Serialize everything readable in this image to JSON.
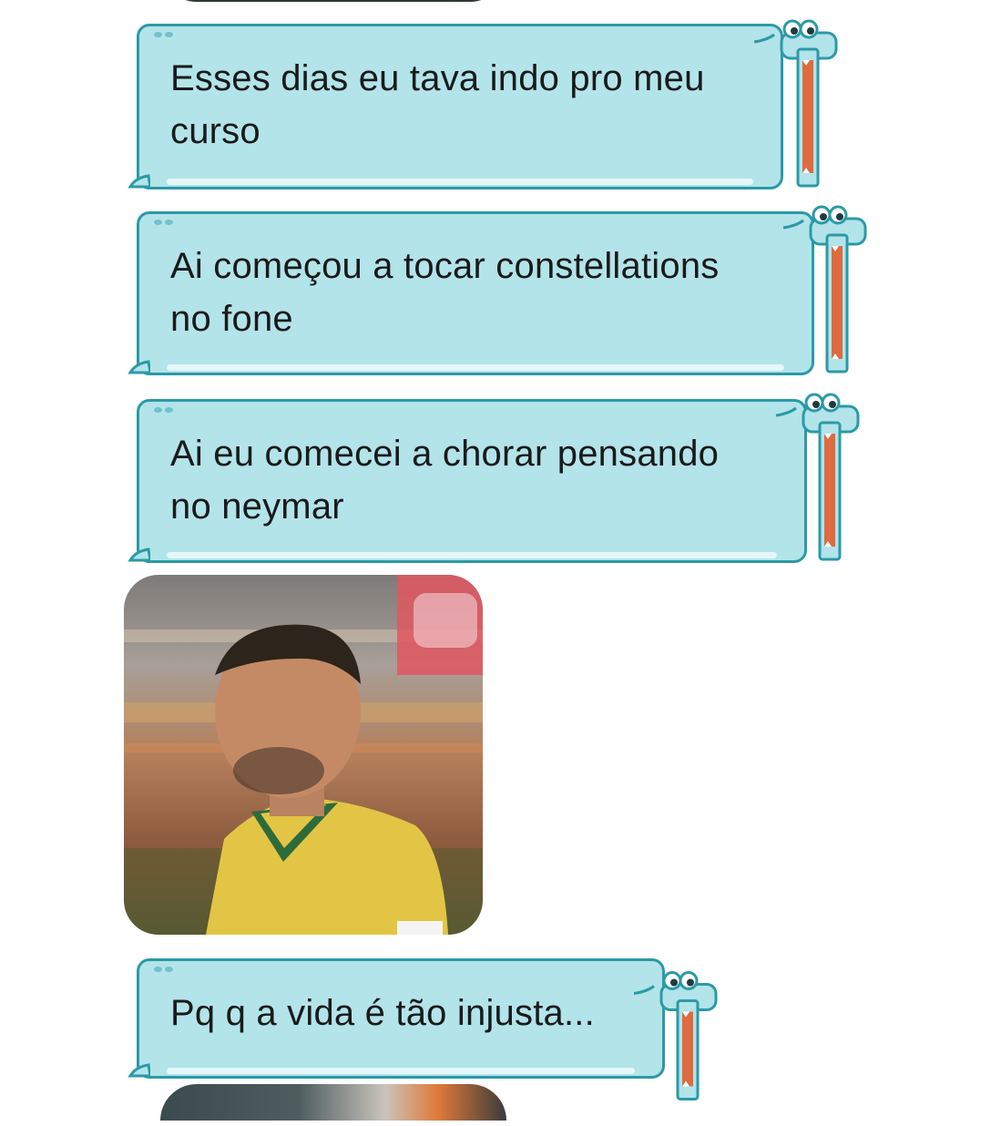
{
  "messages": [
    {
      "type": "text",
      "text": "Esses dias eu tava indo pro meu curso",
      "line1": "Esses dias eu tava indo pro meu",
      "line2": "curso"
    },
    {
      "type": "text",
      "text": "Ai começou a tocar constellations no fone",
      "line1": "Ai começou a tocar constellations",
      "line2": "no fone"
    },
    {
      "type": "text",
      "text": "Ai eu comecei a chorar pensando no neymar",
      "line1": "Ai eu comecei a chorar pensando",
      "line2": "no neymar"
    },
    {
      "type": "image",
      "icon": "crying-player-photo"
    },
    {
      "type": "text",
      "text": "Pq q a vida é tão injusta...",
      "line1": "Pq q a vida é tão injusta...",
      "line2": ""
    }
  ],
  "colors": {
    "bubble_fill": "#b2e4ea",
    "bubble_border": "#2b9aa6",
    "croc_mouth": "#e06a3f",
    "text": "#1a1a1a"
  }
}
